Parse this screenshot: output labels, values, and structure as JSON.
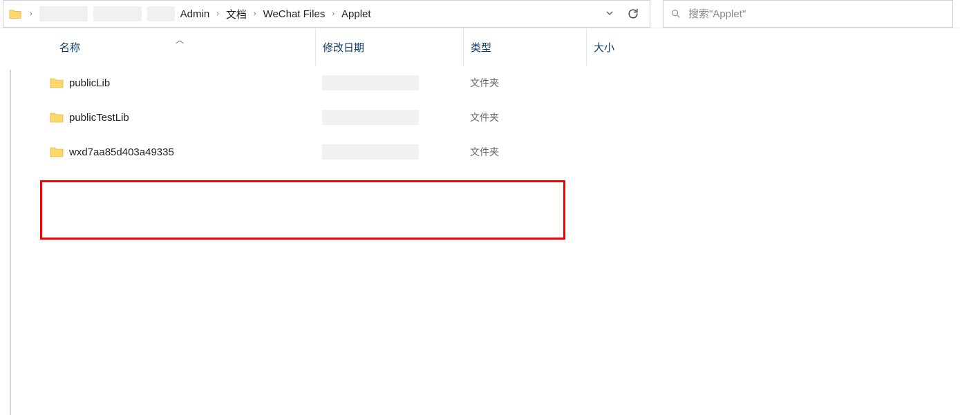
{
  "breadcrumb": {
    "items": [
      "Admin",
      "文档",
      "WeChat Files",
      "Applet"
    ]
  },
  "search": {
    "placeholder": "搜索\"Applet\""
  },
  "columns": {
    "name": "名称",
    "date": "修改日期",
    "type": "类型",
    "size": "大小"
  },
  "rows": [
    {
      "name": "publicLib",
      "type": "文件夹"
    },
    {
      "name": "publicTestLib",
      "type": "文件夹"
    },
    {
      "name": "wxd7aa85d403a49335",
      "type": "文件夹"
    }
  ],
  "annotations": {
    "highlighted_row_index": 2
  }
}
